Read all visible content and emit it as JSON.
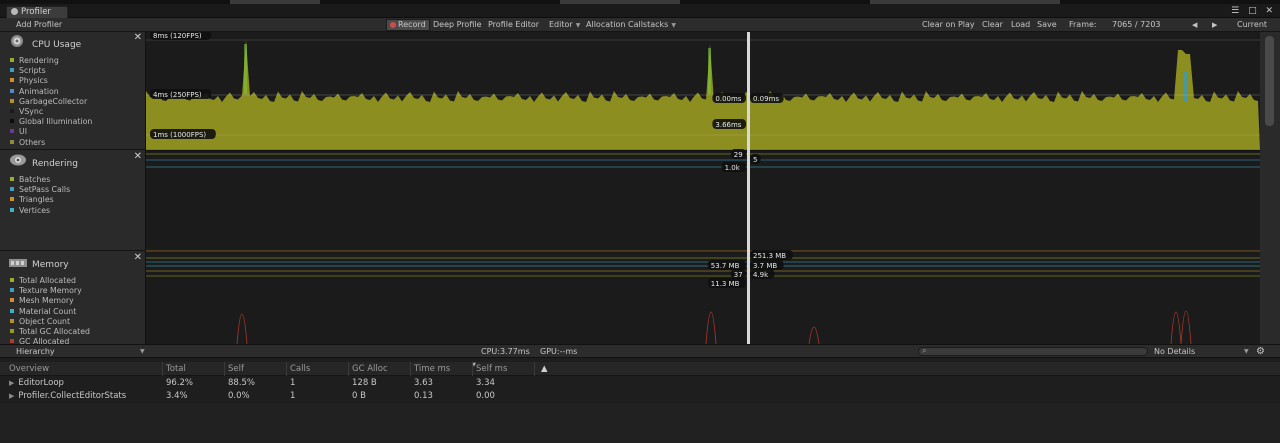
{
  "window": {
    "tab_title": "Profiler",
    "controls": "☰ □ ✕"
  },
  "toolbar": {
    "add_profiler": "Add Profiler",
    "record": "Record",
    "deep_profile": "Deep Profile",
    "profile_editor": "Profile Editor",
    "target": "Editor",
    "allocation_callstacks": "Allocation Callstacks",
    "clear_on_play": "Clear on Play",
    "clear": "Clear",
    "load": "Load",
    "save": "Save",
    "frame_label": "Frame:",
    "frame_value": "7065 / 7203",
    "prev": "◀",
    "next": "▶",
    "current": "Current"
  },
  "modules": {
    "cpu": {
      "title": "CPU Usage",
      "legend": [
        {
          "label": "Rendering",
          "color": "#9cad2e"
        },
        {
          "label": "Scripts",
          "color": "#3aa1c6"
        },
        {
          "label": "Physics",
          "color": "#d38e2c"
        },
        {
          "label": "Animation",
          "color": "#4a8fc0"
        },
        {
          "label": "GarbageCollector",
          "color": "#b3902e"
        },
        {
          "label": "VSync",
          "color": "#1a1a1a"
        },
        {
          "label": "Global Illumination",
          "color": "#0d0d0d"
        },
        {
          "label": "UI",
          "color": "#6a3a8c"
        },
        {
          "label": "Others",
          "color": "#8a8b3c"
        }
      ],
      "guides": [
        "8ms (120FPS)",
        "4ms (250FPS)",
        "1ms (1000FPS)"
      ],
      "selection_labels": [
        "0.00ms",
        "0.09ms",
        "3.66ms"
      ],
      "fill_color": "#8d8e20",
      "spike_color": "#7ccb3a",
      "scripts_color": "#2f9bd0"
    },
    "rendering": {
      "title": "Rendering",
      "legend": [
        {
          "label": "Batches",
          "color": "#9cad2e"
        },
        {
          "label": "SetPass Calls",
          "color": "#3aa1c6"
        },
        {
          "label": "Triangles",
          "color": "#d38e2c"
        },
        {
          "label": "Vertices",
          "color": "#3bb3c7"
        }
      ],
      "selection_labels": [
        "29",
        "5",
        "1.0k"
      ]
    },
    "memory": {
      "title": "Memory",
      "legend": [
        {
          "label": "Total Allocated",
          "color": "#9cad2e"
        },
        {
          "label": "Texture Memory",
          "color": "#3aa1c6"
        },
        {
          "label": "Mesh Memory",
          "color": "#d38e2c"
        },
        {
          "label": "Material Count",
          "color": "#3bb3c7"
        },
        {
          "label": "Object Count",
          "color": "#b3902e"
        },
        {
          "label": "Total GC Allocated",
          "color": "#9a9a1a"
        },
        {
          "label": "GC Allocated",
          "color": "#b03a2e"
        }
      ],
      "selection_labels": [
        "251.3 MB",
        "53.7 MB",
        "3.7 MB",
        "37",
        "4.9k",
        "11.3 MB"
      ]
    }
  },
  "hierarchy": {
    "view": "Hierarchy",
    "cpu": "CPU:3.77ms",
    "gpu": "GPU:--ms",
    "details": "No Details",
    "columns": [
      "Overview",
      "Total",
      "Self",
      "Calls",
      "GC Alloc",
      "Time ms",
      "Self ms",
      "▲"
    ],
    "rows": [
      [
        "EditorLoop",
        "96.2%",
        "88.5%",
        "1",
        "128 B",
        "3.63",
        "3.34"
      ],
      [
        "Profiler.CollectEditorStats",
        "3.4%",
        "0.0%",
        "1",
        "0 B",
        "0.13",
        "0.00"
      ]
    ]
  }
}
